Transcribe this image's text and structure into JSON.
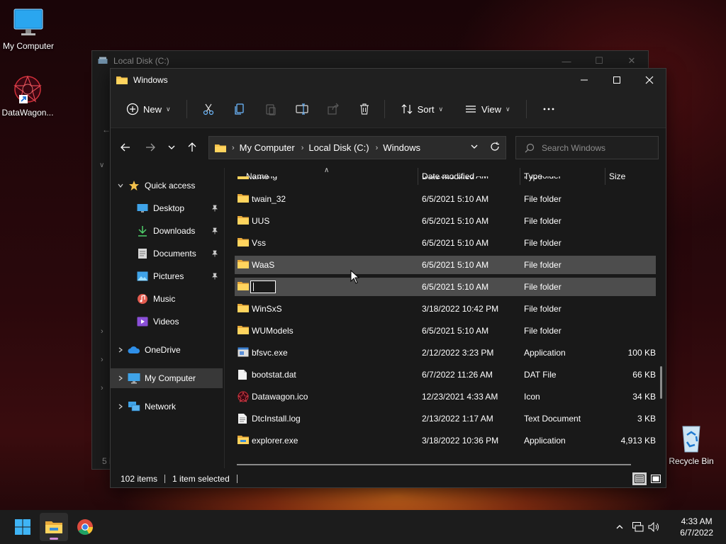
{
  "desktop": {
    "icons": [
      {
        "label": "My Computer"
      },
      {
        "label": "DataWagon..."
      },
      {
        "label": "Recycle Bin"
      }
    ]
  },
  "background_window": {
    "title": "Local Disk (C:)",
    "status_fragment": "5 i"
  },
  "window": {
    "title": "Windows",
    "toolbar": {
      "new_label": "New",
      "sort_label": "Sort",
      "view_label": "View",
      "more_label": "..."
    },
    "breadcrumb": [
      "My Computer",
      "Local Disk (C:)",
      "Windows"
    ],
    "search_placeholder": "Search Windows",
    "nav_pane": {
      "quick_access": "Quick access",
      "items": [
        {
          "label": "Desktop",
          "pinned": true
        },
        {
          "label": "Downloads",
          "pinned": true
        },
        {
          "label": "Documents",
          "pinned": true
        },
        {
          "label": "Pictures",
          "pinned": true
        },
        {
          "label": "Music",
          "pinned": false
        },
        {
          "label": "Videos",
          "pinned": false
        }
      ],
      "onedrive": "OneDrive",
      "my_computer": "My Computer",
      "network": "Network"
    },
    "columns": {
      "name": "Name",
      "date": "Date modified",
      "type": "Type",
      "size": "Size"
    },
    "files": [
      {
        "name": "tracing",
        "date": "6/5/2021 5:10 AM",
        "type": "File folder",
        "size": "",
        "icon": "folder-icon"
      },
      {
        "name": "twain_32",
        "date": "6/5/2021 5:10 AM",
        "type": "File folder",
        "size": "",
        "icon": "folder-icon"
      },
      {
        "name": "UUS",
        "date": "6/5/2021 5:10 AM",
        "type": "File folder",
        "size": "",
        "icon": "folder-icon"
      },
      {
        "name": "Vss",
        "date": "6/5/2021 5:10 AM",
        "type": "File folder",
        "size": "",
        "icon": "folder-icon"
      },
      {
        "name": "WaaS",
        "date": "6/5/2021 5:10 AM",
        "type": "File folder",
        "size": "",
        "icon": "folder-icon"
      },
      {
        "name": "",
        "date": "6/5/2021 5:10 AM",
        "type": "File folder",
        "size": "",
        "icon": "folder-icon"
      },
      {
        "name": "WinSxS",
        "date": "3/18/2022 10:42 PM",
        "type": "File folder",
        "size": "",
        "icon": "folder-icon"
      },
      {
        "name": "WUModels",
        "date": "6/5/2021 5:10 AM",
        "type": "File folder",
        "size": "",
        "icon": "folder-icon"
      },
      {
        "name": "bfsvc.exe",
        "date": "2/12/2022 3:23 PM",
        "type": "Application",
        "size": "100 KB",
        "icon": "app-icon"
      },
      {
        "name": "bootstat.dat",
        "date": "6/7/2022 11:26 AM",
        "type": "DAT File",
        "size": "66 KB",
        "icon": "file-icon"
      },
      {
        "name": "Datawagon.ico",
        "date": "12/23/2021 4:33 AM",
        "type": "Icon",
        "size": "34 KB",
        "icon": "ico-icon"
      },
      {
        "name": "DtcInstall.log",
        "date": "2/13/2022 1:17 AM",
        "type": "Text Document",
        "size": "3 KB",
        "icon": "text-file-icon"
      },
      {
        "name": "explorer.exe",
        "date": "3/18/2022 10:36 PM",
        "type": "Application",
        "size": "4,913 KB",
        "icon": "explorer-icon"
      }
    ],
    "status": {
      "item_count": "102 items",
      "selection": "1 item selected"
    }
  },
  "taskbar": {
    "time": "4:33 AM",
    "date": "6/7/2022"
  },
  "colors": {
    "folder": "#f3c14b",
    "accent": "#4cc2ff",
    "window_bg": "#191919",
    "highlight": "#4d4d4d"
  }
}
